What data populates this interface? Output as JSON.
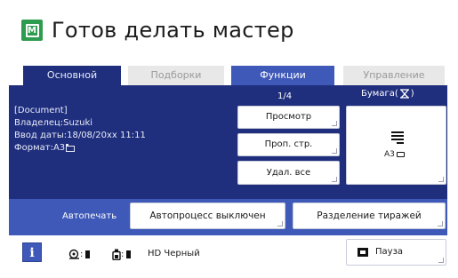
{
  "header": {
    "icon": "master-icon",
    "icon_glyph": "M",
    "title": "Готов делать мастер"
  },
  "tabs": [
    {
      "label": "Основной",
      "state": "active"
    },
    {
      "label": "Подборки",
      "state": "disabled"
    },
    {
      "label": "Функции",
      "state": "normal"
    },
    {
      "label": "Управление",
      "state": "disabled"
    }
  ],
  "doc_info": {
    "document": "[Document]",
    "owner": "Владелец:Suzuki",
    "input_date": "Ввод даты:18/08/20xx 11:11",
    "format": "Формат:A3"
  },
  "counter": "1/4",
  "paper": {
    "label": "Бумага(",
    "label_end": ")",
    "size": "A3"
  },
  "buttons": {
    "preview": "Просмотр",
    "skip_pages": "Проп. стр.",
    "delete_all": "Удал. все",
    "auto_process": "Автопроцесс выключен",
    "job_separation": "Разделение тиражей",
    "pause": "Пауза"
  },
  "auto_print_label": "Автопечать",
  "status": {
    "info_glyph": "i",
    "ink_label": ":",
    "bottle_label": ":",
    "hd_label": "HD Черный"
  },
  "colors": {
    "panel_dark": "#1f2f7e",
    "panel_mid": "#3e59b8",
    "master_icon": "#2e9c4e"
  }
}
